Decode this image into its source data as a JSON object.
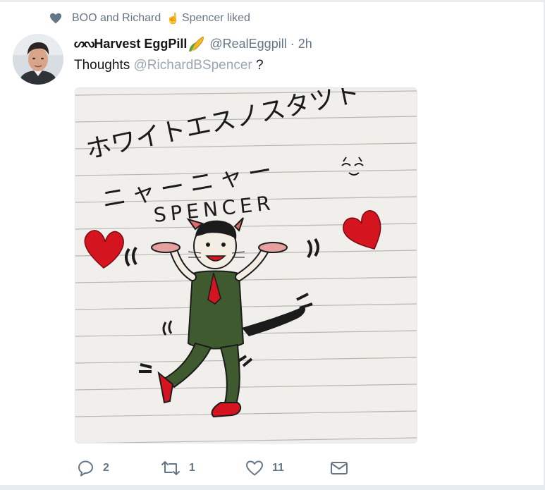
{
  "social_context": {
    "text_a": "BOO and Richard",
    "text_b": "Spencer liked"
  },
  "tweet": {
    "display_glyph": "ᔕᔓ",
    "display_name": "Harvest EggPill",
    "handle": "@RealEggpill",
    "separator": "·",
    "time": "2h",
    "text_before": "Thoughts",
    "mention": "@RichardBSpencer",
    "text_after": "?"
  },
  "image": {
    "handwriting_line1": "ホワイトエスノスタツト",
    "handwriting_line2": "ニャーニャー",
    "handwriting_name": "SPENCER",
    "paper_color": "#f1efeb",
    "ink_color": "#1b1b1b",
    "heart_color": "#d4141f",
    "suit_color": "#3e5a2e"
  },
  "actions": {
    "replies": "2",
    "retweets": "1",
    "likes": "11"
  },
  "colors": {
    "muted": "#657786",
    "mention": "#98a6b3",
    "divider": "#e6ecf0"
  }
}
